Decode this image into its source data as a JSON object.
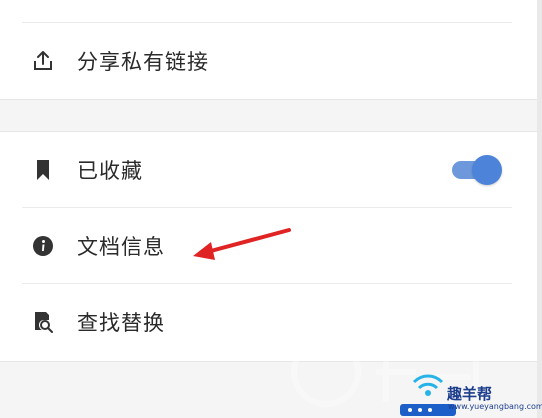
{
  "menu": {
    "share": {
      "label": "分享私有链接",
      "icon": "share-icon"
    },
    "bookmarked": {
      "label": "已收藏",
      "icon": "bookmark-icon",
      "toggle_on": true
    },
    "doc_info": {
      "label": "文档信息",
      "icon": "info-icon"
    },
    "find_replace": {
      "label": "查找替换",
      "icon": "find-replace-icon"
    }
  },
  "watermark": {
    "brand": "趣羊帮",
    "url": "www.yueyangbang.com"
  },
  "colors": {
    "toggle_track": "#6e98dc",
    "toggle_knob": "#4d84d9",
    "arrow": "#e02424",
    "watermark_text": "#1d3e8c"
  }
}
